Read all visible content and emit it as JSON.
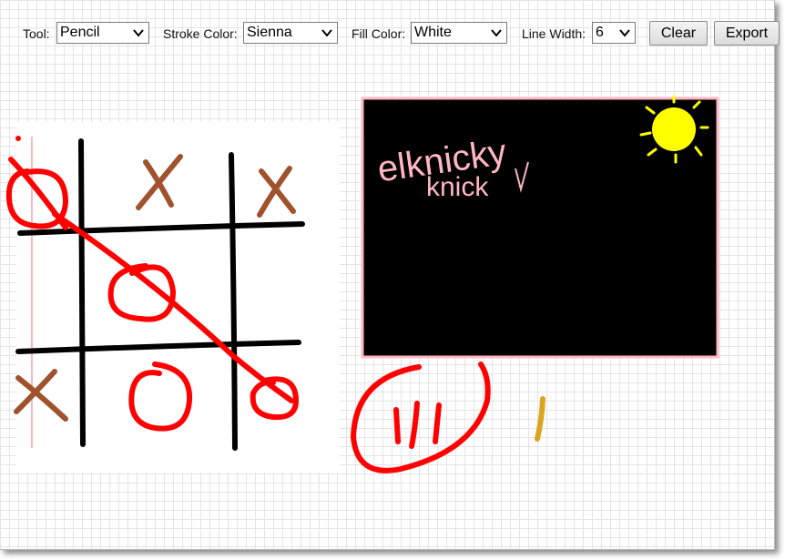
{
  "toolbar": {
    "tool": {
      "label": "Tool:",
      "value": "Pencil"
    },
    "stroke_color": {
      "label": "Stroke Color:",
      "value": "Sienna"
    },
    "fill_color": {
      "label": "Fill Color:",
      "value": "White"
    },
    "line_width": {
      "label": "Line Width:",
      "value": "6"
    },
    "clear_label": "Clear",
    "export_label": "Export"
  },
  "canvas": {
    "handwriting_line1": "elknicky",
    "handwriting_line2": "knick",
    "colors": {
      "black": "#000000",
      "red": "#ff0000",
      "sienna": "#a0522d",
      "pink": "#ffb6c1",
      "yellow": "#ffff00",
      "gold": "#daa520",
      "white": "#ffffff"
    }
  }
}
